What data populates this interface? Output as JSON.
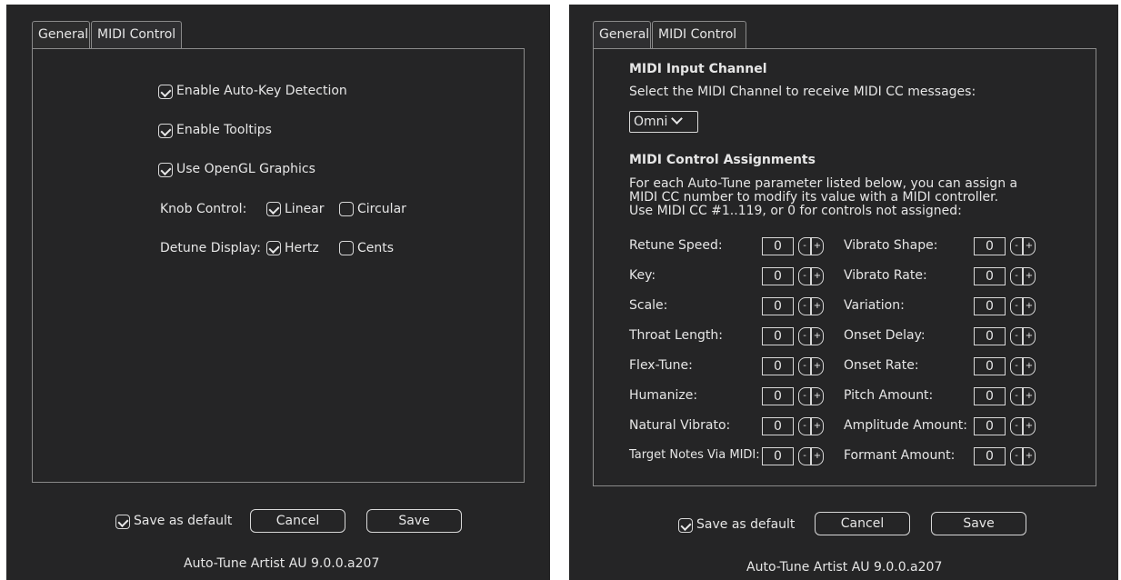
{
  "left": {
    "tabs": [
      {
        "label": "General",
        "active": true
      },
      {
        "label": "MIDI Control",
        "active": false
      }
    ],
    "general": {
      "auto_key": {
        "label": "Enable Auto-Key Detection",
        "checked": true
      },
      "tooltips": {
        "label": "Enable Tooltips",
        "checked": true
      },
      "opengl": {
        "label": "Use OpenGL Graphics",
        "checked": true
      },
      "knob_control": {
        "label": "Knob Control:",
        "options": [
          {
            "label": "Linear",
            "checked": true
          },
          {
            "label": "Circular",
            "checked": false
          }
        ]
      },
      "detune_display": {
        "label": "Detune Display:",
        "options": [
          {
            "label": "Hertz",
            "checked": true
          },
          {
            "label": "Cents",
            "checked": false
          }
        ]
      }
    },
    "footer": {
      "save_default": {
        "label": "Save as default",
        "checked": true
      },
      "cancel_label": "Cancel",
      "save_label": "Save",
      "version": "Auto-Tune Artist AU 9.0.0.a207"
    }
  },
  "right": {
    "tabs": [
      {
        "label": "General",
        "active": false
      },
      {
        "label": "MIDI Control",
        "active": true
      }
    ],
    "midi": {
      "input_heading": "MIDI Input Channel",
      "input_desc": "Select the MIDI Channel to receive MIDI CC messages:",
      "channel_value": "Omni",
      "assign_heading": "MIDI Control Assignments",
      "assign_desc": [
        "For each Auto-Tune parameter listed below, you can assign a",
        "MIDI CC number to modify its value with a MIDI controller.",
        "Use MIDI CC #1..119, or 0 for controls not assigned:"
      ],
      "left_params": [
        {
          "label": "Retune Speed:",
          "value": "0"
        },
        {
          "label": "Key:",
          "value": "0"
        },
        {
          "label": "Scale:",
          "value": "0"
        },
        {
          "label": "Throat Length:",
          "value": "0"
        },
        {
          "label": "Flex-Tune:",
          "value": "0"
        },
        {
          "label": "Humanize:",
          "value": "0"
        },
        {
          "label": "Natural Vibrato:",
          "value": "0"
        },
        {
          "label": "Target Notes Via MIDI:",
          "value": "0"
        }
      ],
      "right_params": [
        {
          "label": "Vibrato Shape:",
          "value": "0"
        },
        {
          "label": "Vibrato Rate:",
          "value": "0"
        },
        {
          "label": "Variation:",
          "value": "0"
        },
        {
          "label": "Onset Delay:",
          "value": "0"
        },
        {
          "label": "Onset Rate:",
          "value": "0"
        },
        {
          "label": "Pitch Amount:",
          "value": "0"
        },
        {
          "label": "Amplitude Amount:",
          "value": "0"
        },
        {
          "label": "Formant Amount:",
          "value": "0"
        }
      ],
      "minus_glyph": "-",
      "plus_glyph": "+"
    },
    "footer": {
      "save_default": {
        "label": "Save as default",
        "checked": true
      },
      "cancel_label": "Cancel",
      "save_label": "Save",
      "version": "Auto-Tune Artist AU 9.0.0.a207"
    }
  }
}
